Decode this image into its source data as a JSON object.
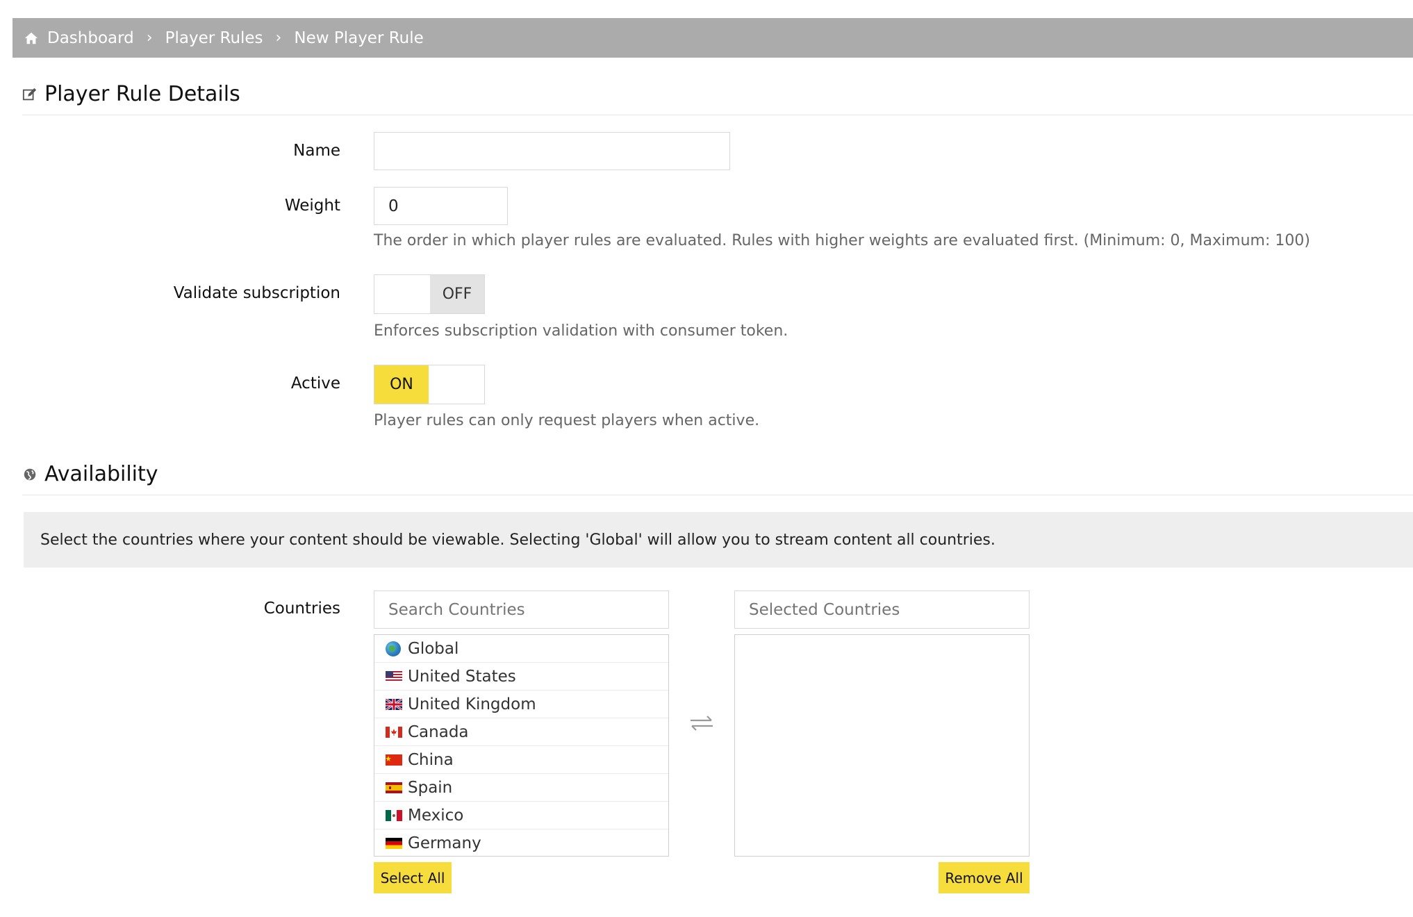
{
  "breadcrumb": {
    "items": [
      "Dashboard",
      "Player Rules",
      "New Player Rule"
    ]
  },
  "details_section": {
    "title": "Player Rule Details"
  },
  "form": {
    "name": {
      "label": "Name",
      "value": ""
    },
    "weight": {
      "label": "Weight",
      "value": "0",
      "help": "The order in which player rules are evaluated. Rules with higher weights are evaluated first. (Minimum: 0, Maximum: 100)"
    },
    "validate_subscription": {
      "label": "Validate subscription",
      "state": "OFF",
      "help": "Enforces subscription validation with consumer token."
    },
    "active": {
      "label": "Active",
      "state": "ON",
      "help": "Player rules can only request players when active."
    }
  },
  "availability_section": {
    "title": "Availability",
    "info": "Select the countries where your content should be viewable. Selecting 'Global' will allow you to stream content all countries."
  },
  "countries": {
    "label": "Countries",
    "search_placeholder": "Search Countries",
    "selected_placeholder": "Selected Countries",
    "available": [
      {
        "name": "Global",
        "icon": "globe-icon"
      },
      {
        "name": "United States",
        "icon": "flag-us-icon"
      },
      {
        "name": "United Kingdom",
        "icon": "flag-uk-icon"
      },
      {
        "name": "Canada",
        "icon": "flag-ca-icon"
      },
      {
        "name": "China",
        "icon": "flag-cn-icon"
      },
      {
        "name": "Spain",
        "icon": "flag-es-icon"
      },
      {
        "name": "Mexico",
        "icon": "flag-mx-icon"
      },
      {
        "name": "Germany",
        "icon": "flag-de-icon"
      }
    ],
    "selected": [],
    "select_all_label": "Select All",
    "remove_all_label": "Remove All"
  },
  "colors": {
    "accent": "#f7dd3b",
    "breadcrumb_bg": "#ababab",
    "info_bg": "#eeeeee"
  }
}
